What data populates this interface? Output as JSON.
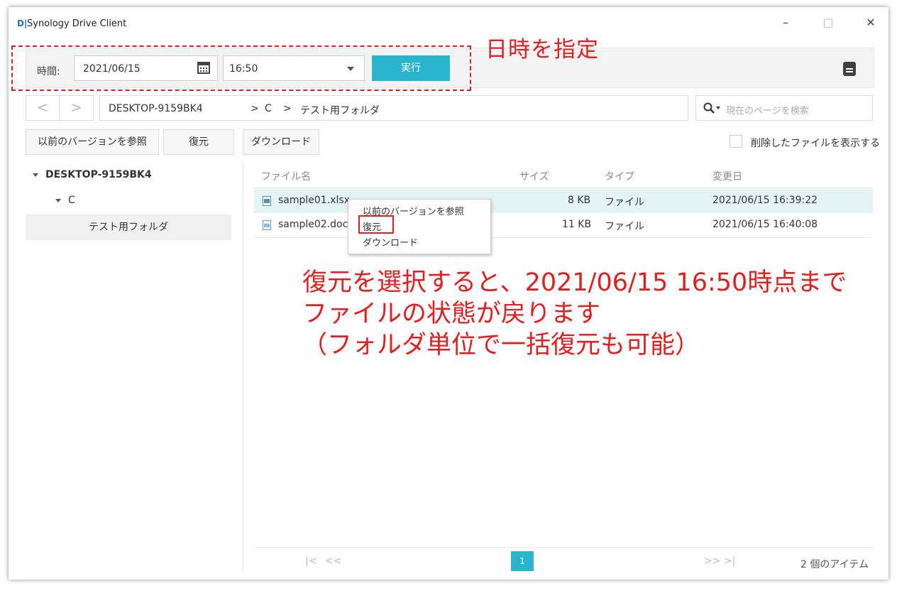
{
  "app": {
    "logo": "D|",
    "title": "Synology Drive Client"
  },
  "window_controls": {
    "minimize": "–",
    "maximize": "□",
    "close": "✕"
  },
  "toolbar": {
    "time_label": "時間:",
    "date_value": "2021/06/15",
    "time_value": "16:50",
    "run_label": "実行",
    "note_icon": "note-icon"
  },
  "nav": {
    "back": "<",
    "forward": ">"
  },
  "breadcrumb": {
    "root": "DESKTOP-9159BK4",
    "sep1": ">",
    "c": "C",
    "sep2": ">",
    "folder": "テスト用フォルダ"
  },
  "search": {
    "icon": "search-icon",
    "placeholder": "現在のページを検索"
  },
  "actions": {
    "browse_versions": "以前のバージョンを参照",
    "restore": "復元",
    "download": "ダウンロード",
    "show_deleted": "削除したファイルを表示する"
  },
  "tree": {
    "root": "DESKTOP-9159BK4",
    "c": "C",
    "folder": "テスト用フォルダ"
  },
  "table": {
    "headers": {
      "name": "ファイル名",
      "size": "サイズ",
      "type": "タイプ",
      "modified": "変更日"
    },
    "rows": [
      {
        "name": "sample01.xlsx",
        "size": "8 KB",
        "type": "ファイル",
        "modified": "2021/06/15 16:39:22"
      },
      {
        "name": "sample02.doc",
        "size": "11 KB",
        "type": "ファイル",
        "modified": "2021/06/15 16:40:08"
      }
    ]
  },
  "context_menu": {
    "items": [
      "以前のバージョンを参照",
      "復元",
      "ダウンロード"
    ]
  },
  "annotations": {
    "specify_datetime": "日時を指定",
    "restore_note_line1": "復元を選択すると、2021/06/15 16:50時点まで",
    "restore_note_line2": "ファイルの状態が戻ります",
    "restore_note_line3": "（フォルダ単位で一括復元も可能）"
  },
  "pagination": {
    "first": "|<",
    "prev": "<<",
    "current": "1",
    "next": ">>",
    "last": ">|",
    "count": "2 個のアイテム"
  },
  "colors": {
    "accent": "#2ab4cc",
    "annotation": "#e02020"
  }
}
